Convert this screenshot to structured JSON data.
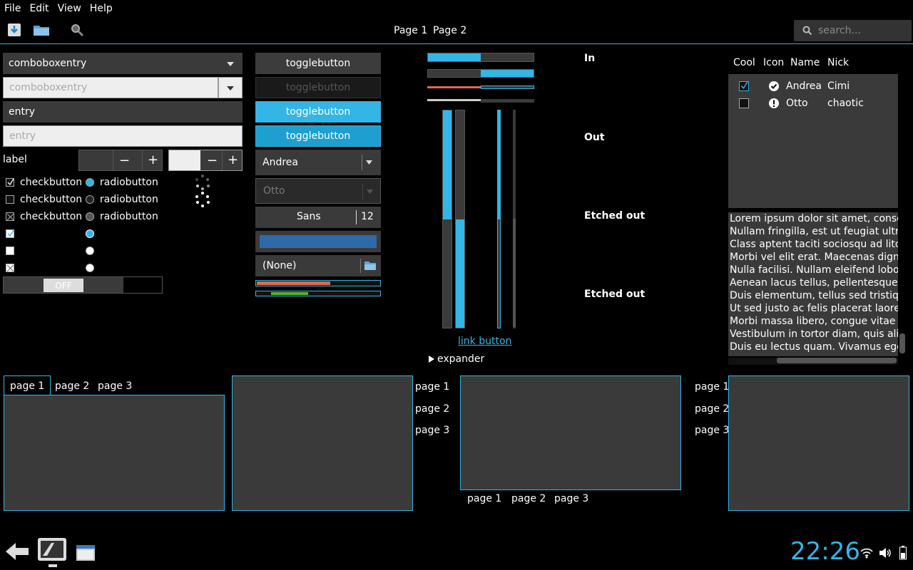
{
  "menu": [
    "File",
    "Edit",
    "View",
    "Help"
  ],
  "toolbar": {
    "page1": "Page 1",
    "page2": "Page 2",
    "search_placeholder": "search..."
  },
  "combo": {
    "entry1": "comboboxentry",
    "entry2": "comboboxentry",
    "entry3": "entry",
    "entry4": "entry"
  },
  "label": "label",
  "checks": {
    "checkbutton": "checkbutton",
    "radiobutton": "radiobutton"
  },
  "switch_label": "OFF",
  "toggles": [
    "togglebutton",
    "togglebutton",
    "togglebutton",
    "togglebutton"
  ],
  "combos": {
    "andrea": "Andrea",
    "otto": "Otto"
  },
  "font": {
    "name": "Sans",
    "size": "12"
  },
  "file_chooser": "(None)",
  "progress": {
    "h1": 0.5,
    "h2": 0.5,
    "h3": 0.5,
    "h4": 0.5,
    "red": 0.6,
    "green": 0.3
  },
  "frames": {
    "in": "In",
    "out": "Out",
    "etched1": "Etched out",
    "etched2": "Etched out"
  },
  "link_button": "link button",
  "expander": "expander",
  "tree": {
    "headers": [
      "Cool",
      "Icon",
      "Name",
      "Nick"
    ],
    "rows": [
      {
        "cool": true,
        "icon": "check-circle-icon",
        "name": "Andrea",
        "nick": "Cimi"
      },
      {
        "cool": false,
        "icon": "warning-icon",
        "name": "Otto",
        "nick": "chaotic"
      }
    ]
  },
  "lorem": [
    "Lorem ipsum dolor sit amet, consec",
    "Nullam fringilla, est ut feugiat ultric",
    "Class aptent taciti sociosqu ad litora",
    "Morbi vel elit erat. Maecenas dignis",
    "Nulla facilisi. Nullam eleifend lobor",
    "Aenean lacus tellus, pellentesque c",
    "Duis elementum, tellus sed tristiqu",
    "Ut sed justo ac felis placerat laoree",
    "Morbi massa libero, congue vitae so",
    "Vestibulum in tortor diam, quis aliq",
    "Duis eu lectus quam. Vivamus eget"
  ],
  "notebook_tabs": [
    "page 1",
    "page 2",
    "page 3"
  ],
  "clock": "22:26",
  "colors": {
    "accent": "#33b5e5",
    "red": "#e0694f",
    "green": "#5ab035"
  }
}
